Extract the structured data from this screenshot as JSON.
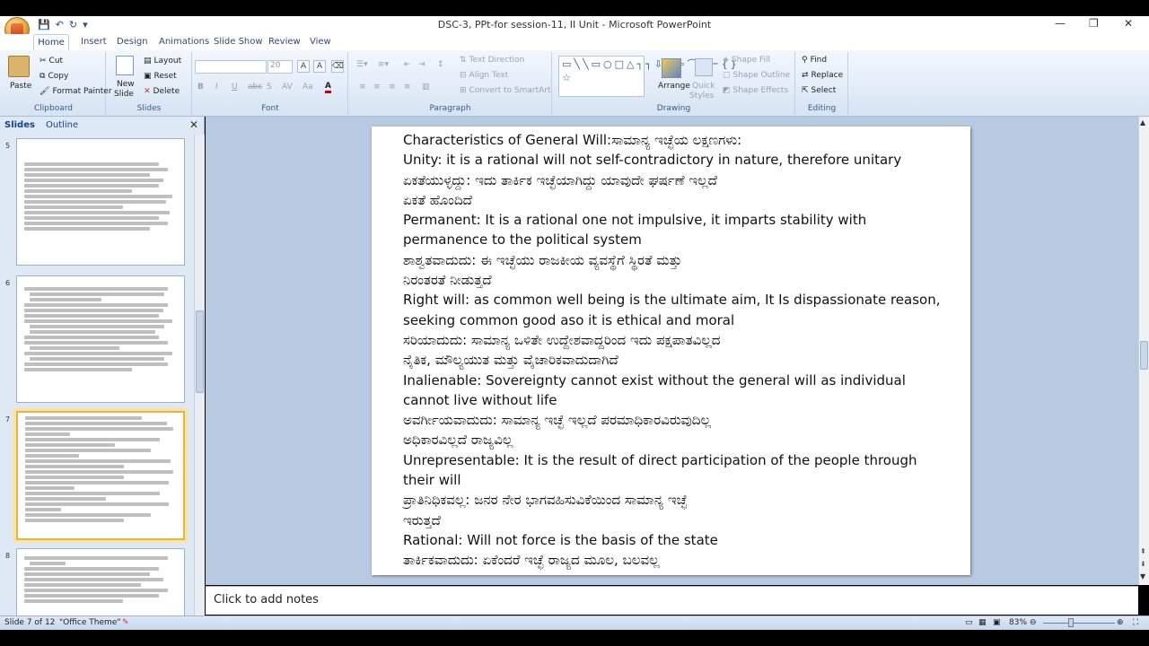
{
  "window": {
    "title": "DSC-3, PPt-for session-11, II Unit - Microsoft PowerPoint",
    "controls": [
      "—",
      "❐",
      "✕"
    ]
  },
  "tabs": [
    "Home",
    "Insert",
    "Design",
    "Animations",
    "Slide Show",
    "Review",
    "View"
  ],
  "ribbon": {
    "clipboard": {
      "label": "Clipboard",
      "paste": "Paste",
      "cut": "Cut",
      "copy": "Copy",
      "format_painter": "Format Painter"
    },
    "slides": {
      "label": "Slides",
      "new_slide": "New",
      "new_slide2": "Slide",
      "layout": "Layout",
      "reset": "Reset",
      "delete": "Delete"
    },
    "font": {
      "label": "Font",
      "size": "20"
    },
    "paragraph": {
      "label": "Paragraph",
      "text_direction": "Text Direction",
      "align_text": "Align Text",
      "convert": "Convert to SmartArt"
    },
    "drawing": {
      "label": "Drawing",
      "arrange": "Arrange",
      "quick_styles": "Quick",
      "quick_styles2": "Styles",
      "shape_fill": "Shape Fill",
      "shape_outline": "Shape Outline",
      "shape_effects": "Shape Effects"
    },
    "editing": {
      "label": "Editing",
      "find": "Find",
      "replace": "Replace",
      "select": "Select"
    }
  },
  "panel": {
    "tab_slides": "Slides",
    "tab_outline": "Outline",
    "thumb_numbers": [
      "5",
      "6",
      "7",
      "8"
    ]
  },
  "slide_lines": [
    "Characteristics of General Will:ಸಾಮಾನ್ಯ ಇಚ್ಛೆಯ ಲಕ್ಷಣಗಳು:",
    "Unity: it is a rational will not self-contradictory in nature, therefore unitary",
    "ಏಕತೆಯುಳ್ಳದ್ದು: ಇದು ತಾರ್ಕಿಕ ಇಚ್ಛೆಯಾಗಿದ್ದು ಯಾವುದೇ ಘರ್ಷಣೆ ಇಲ್ಲದೆ",
    "ಏಕತೆ ಹೊಂದಿದೆ",
    "Permanent: It is a rational one not impulsive, it imparts stability with",
    " permanence to the political system",
    "ಶಾಶ್ವತವಾದುದು:  ಈ ಇಚ್ಛೆಯು ರಾಜಕೀಯ ವ್ಯವಸ್ಥೆಗೆ ಸ್ಥಿರತೆ ಮತ್ತು",
    "ನಿರಂತರತೆ ನೀಡುತ್ತದೆ",
    "Right will: as common well being is the ultimate aim, It Is dispassionate reason,",
    "seeking common good aso it is ethical and moral",
    "ಸರಿಯಾದುದು:  ಸಾಮಾನ್ಯ ಒಳಿತೇ ಉದ್ದೇಶವಾದ್ದರಿಂದ ಇದು ಪಕ್ಷಪಾತವಿಲ್ಲದ",
    "ನೈತಿಕ, ಮೌಲ್ಯಯುತ ಮತ್ತು ವೈಚಾರಿಕವಾದುದಾಗಿದೆ",
    "Inalienable: Sovereignty cannot exist without the general will as individual",
    "cannot live without life",
    "ಅವರ್ಗೀಯವಾದುದು: ಸಾಮಾನ್ಯ ಇಚ್ಛೆ ಇಲ್ಲದೆ ಪರಮಾಧಿಕಾರವಿರುವುದಿಲ್ಲ",
    "ಅಧಿಕಾರವಿಲ್ಲದೆ ರಾಜ್ಯವಿಲ್ಲ",
    "Unrepresentable: It is the result of direct participation of the people through",
    "their will",
    "ಪ್ರಾತಿನಿಧಿಕವಲ್ಲ: ಜನರ ನೇರ ಭಾಗವಹಿಸುವಿಕೆಯಿಂದ ಸಾಮಾನ್ಯ ಇಚ್ಛೆ",
    "ಇರುತ್ತದೆ",
    "Rational: Will not force is the basis of the state",
    "ತಾರ್ಕಿಕವಾದುದು: ಏಕೆಂದರೆ ಇಚ್ಛೆ ರಾಜ್ಯದ ಮೂಲ, ಬಲವಲ್ಲ"
  ],
  "notes_placeholder": "Click to add notes",
  "status": {
    "slide_info": "Slide 7 of 12",
    "theme": "\"Office Theme\"",
    "zoom": "83%"
  }
}
